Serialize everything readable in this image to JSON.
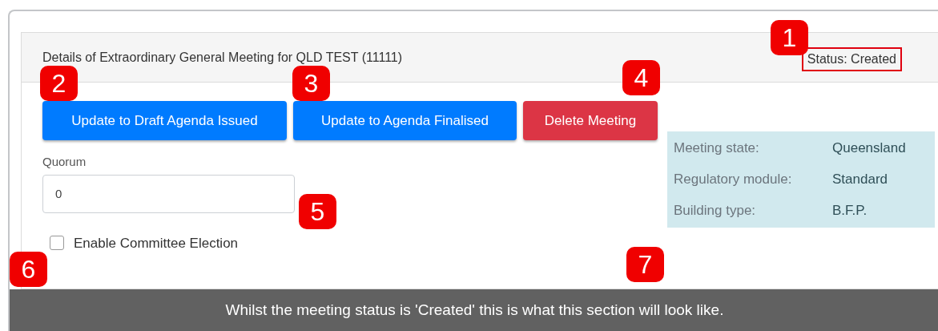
{
  "panel": {
    "title": "Details of Extraordinary General Meeting for QLD TEST (11111)",
    "status": {
      "text": "Status: Created",
      "highlighted": true
    }
  },
  "actions": [
    {
      "label": "Update to Draft Agenda Issued",
      "kind": "primary"
    },
    {
      "label": "Update to Agenda Finalised",
      "kind": "primary"
    },
    {
      "label": "Delete Meeting",
      "kind": "danger"
    }
  ],
  "quorum": {
    "label": "Quorum",
    "value": "0"
  },
  "committee_election": {
    "label": "Enable Committee Election",
    "checked": false
  },
  "info": [
    {
      "label": "Meeting state:",
      "value": "Queensland"
    },
    {
      "label": "Regulatory module:",
      "value": "Standard"
    },
    {
      "label": "Building type:",
      "value": "B.F.P."
    }
  ],
  "callouts": [
    "1",
    "2",
    "3",
    "4",
    "5",
    "6",
    "7"
  ],
  "caption": "Whilst the meeting status is 'Created' this is what this section will look like."
}
